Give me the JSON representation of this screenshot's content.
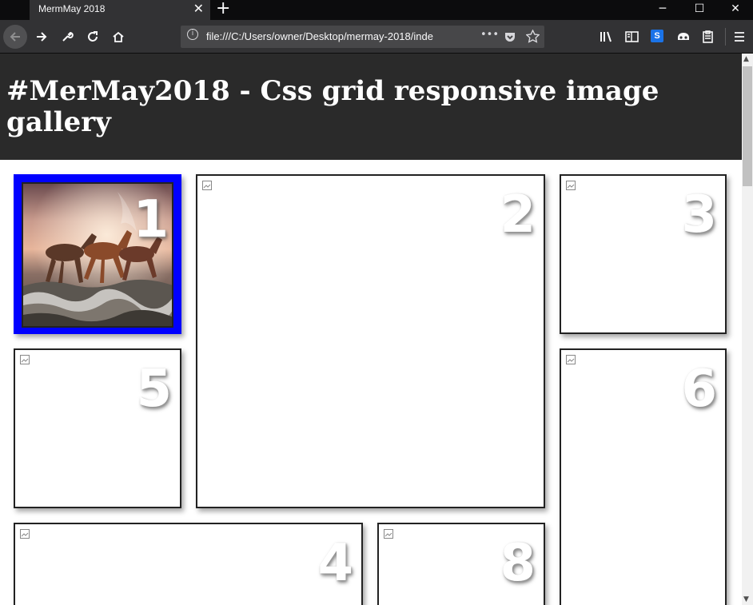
{
  "browser": {
    "tab_title": "MermMay 2018",
    "tab_close": "✕",
    "new_tab": "+",
    "url": "file:///C:/Users/owner/Desktop/mermay-2018/inde",
    "url_info_glyph": "i",
    "page_actions_glyph": "•••",
    "window": {
      "minimize": "─",
      "maximize": "☐",
      "close": "✕"
    }
  },
  "page": {
    "title": "#MerMay2018 - Css grid responsive image gallery"
  },
  "gallery": {
    "items": [
      {
        "number": "1"
      },
      {
        "number": "2"
      },
      {
        "number": "3"
      },
      {
        "number": "5"
      },
      {
        "number": "6"
      },
      {
        "number": "4"
      },
      {
        "number": "8"
      }
    ]
  },
  "colors": {
    "header_bg": "#2a2a2a",
    "featured_border": "#0000ff"
  }
}
